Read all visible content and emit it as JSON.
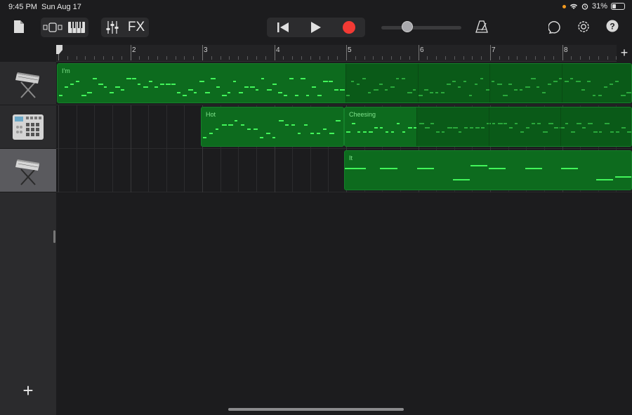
{
  "status": {
    "time": "9:45 PM",
    "date": "Sun Aug 17",
    "battery": "31%"
  },
  "toolbar": {
    "fx_label": "FX",
    "icons": [
      "document-icon",
      "view-toggle-icon",
      "keyboard-icon",
      "mixer-icon",
      "rewind-icon",
      "play-icon",
      "record-icon",
      "metronome-icon",
      "loop-icon",
      "settings-icon",
      "help-icon"
    ],
    "record_color": "#f33a34"
  },
  "ruler": {
    "bars": [
      "2",
      "3",
      "4",
      "5",
      "6",
      "7",
      "8"
    ],
    "add_label": "+"
  },
  "tracks": [
    {
      "instrument": "keyboard",
      "regions": [
        {
          "name": "I'm"
        }
      ]
    },
    {
      "instrument": "drum machine",
      "regions": [
        {
          "name": "Hot"
        },
        {
          "name": "Cheesing"
        }
      ]
    },
    {
      "instrument": "keyboard",
      "regions": [
        {
          "name": "It"
        }
      ]
    }
  ],
  "sidebar": {
    "add_track_label": "+"
  },
  "colors": {
    "region": "#0d6b1e",
    "note": "#42f55a",
    "selected_header": "#5a5a5e"
  }
}
